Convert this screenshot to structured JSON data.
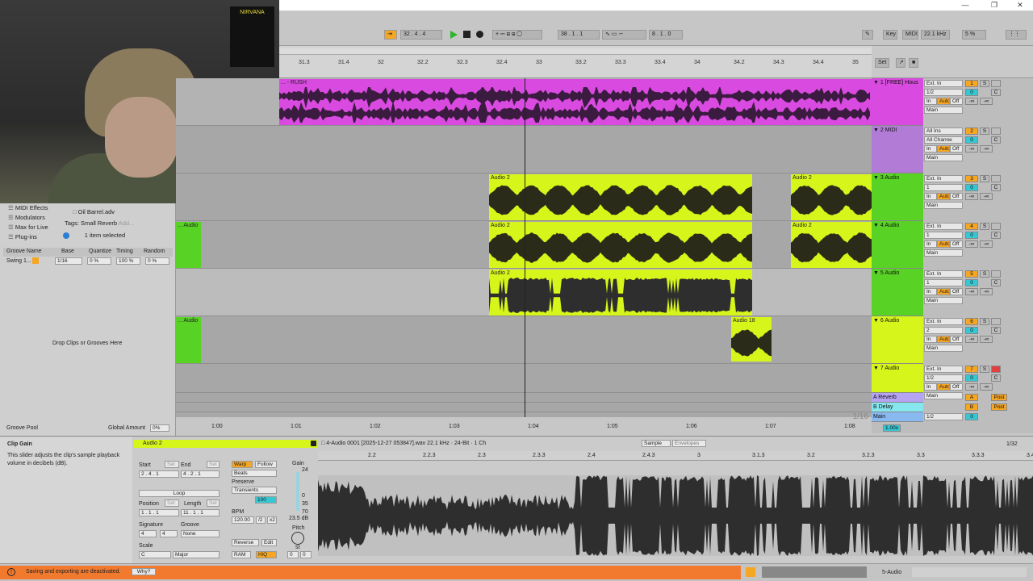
{
  "webcam": {
    "poster_text": "NIRVANA"
  },
  "transport": {
    "tempo_pos": "32 .  4 .  4",
    "loop_pos": "38 .  1 .  1",
    "loop_len": "8 .  1 .  0",
    "key_label": "Key",
    "midi_label": "MIDI",
    "sample_rate": "22.1 kHz",
    "cpu": "5 %"
  },
  "ruler": {
    "ticks": [
      "31.3",
      "31.4",
      "32",
      "32.2",
      "32.3",
      "32.4",
      "33",
      "33.2",
      "33.3",
      "33.4",
      "34",
      "34.2",
      "34.3",
      "34.4",
      "35"
    ],
    "set_label": "Set"
  },
  "time_ticks": [
    "1:00",
    "1:01",
    "1:02",
    "1:03",
    "1:04",
    "1:05",
    "1:06",
    "1:07",
    "1:08"
  ],
  "zoom_label": "1/16",
  "clips": {
    "rush": "... - RUSH",
    "audio2": "Audio 2",
    "audio18": "Audio 18",
    "left_audio": "... Audio"
  },
  "browser": {
    "midi_effects": "MIDI Effects",
    "modulators": "Modulators",
    "max_for_live": "Max for Live",
    "plugins": "Plug-ins",
    "file": "Oil Barrel.adv",
    "tags_label": "Tags:",
    "tags_value": "Small Reverb",
    "tags_add": "Add...",
    "selected": "1 item selected",
    "groove_headers": [
      "Groove Name",
      "Base",
      "Quantize",
      "Timing",
      "Random"
    ],
    "groove_row": [
      "Swing 1...",
      "1/16",
      "0 %",
      "100 %",
      "0 %"
    ],
    "drop_hint": "Drop Clips or Grooves Here",
    "groove_pool": "Groove Pool",
    "global_amount_label": "Global Amount",
    "global_amount_value": "0%"
  },
  "mixer": {
    "tracks": [
      {
        "name": "1 [FREE] Hous",
        "input": "Ext. In",
        "chan": "1/2",
        "num": "1",
        "vol": "0",
        "pan": "C",
        "out": "Main"
      },
      {
        "name": "2 MIDI",
        "input": "All Ins",
        "chan": "All Channe",
        "num": "2",
        "vol": "0",
        "pan": "C",
        "out": "Main"
      },
      {
        "name": "3 Audio",
        "input": "Ext. In",
        "chan": "1",
        "num": "3",
        "vol": "0",
        "pan": "C",
        "out": "Main"
      },
      {
        "name": "4 Audio",
        "input": "Ext. In",
        "chan": "1",
        "num": "4",
        "vol": "0",
        "pan": "C",
        "out": "Main"
      },
      {
        "name": "5 Audio",
        "input": "Ext. In",
        "chan": "1",
        "num": "5",
        "vol": "0",
        "pan": "C",
        "out": "Main"
      },
      {
        "name": "6 Audio",
        "input": "Ext. In",
        "chan": "2",
        "num": "6",
        "vol": "0",
        "pan": "C",
        "out": "Main"
      },
      {
        "name": "7 Audio",
        "input": "Ext. In",
        "chan": "1/2",
        "num": "7",
        "vol": "0",
        "pan": "C",
        "out": "Main"
      }
    ],
    "returns": [
      {
        "name": "A Reverb",
        "letter": "A",
        "post": "Post"
      },
      {
        "name": "B Delay",
        "letter": "B",
        "post": "Post"
      }
    ],
    "main": {
      "name": "Main",
      "chan": "1/2",
      "vol": "0"
    },
    "mon_in": "In",
    "mon_auto": "Auto",
    "mon_off": "Off",
    "inf": "-∞",
    "s": "S",
    "zoom": "1.00x"
  },
  "detail": {
    "info_title": "Clip Gain",
    "info_text": "This slider adjusts the clip's sample playback volume in decibels (dB).",
    "clip_name": "Audio 2",
    "start_label": "Start",
    "end_label": "End",
    "set": "Set",
    "start_val": "2 .  4 .  1",
    "end_val": "4 .  2 .  1",
    "loop": "Loop",
    "position_label": "Position",
    "length_label": "Length",
    "position_val": "1 .  1 .  1",
    "length_val": "11 .  1 .  1",
    "signature_label": "Signature",
    "sig_num": "4",
    "sig_den": "4",
    "groove_label": "Groove",
    "groove_val": "None",
    "scale_label": "Scale",
    "scale_root": "C",
    "scale_mode": "Major",
    "warp": "Warp",
    "follow": "Follow",
    "beats": "Beats",
    "preserve_label": "Preserve",
    "preserve_val": "Transients",
    "pct": "100",
    "bpm_label": "BPM",
    "bpm": "120.00",
    "half": "/2",
    "double": "x2",
    "gain_label": "Gain",
    "gain_db": "23.5 dB",
    "gain_top": "24",
    "gain_scale": [
      "0",
      "35",
      "70"
    ],
    "pitch_label": "Pitch",
    "pitch_st": "st",
    "pitch_val": "0",
    "pitch_cents": "0",
    "reverse": "Reverse",
    "edit": "Edit",
    "ram": "RAM",
    "hiq": "HiQ",
    "file_info": "4-Audio 0001 [2025-12-27 053847].wav  22.1 kHz · 24-Bit · 1 Ch",
    "tab_sample": "Sample",
    "tab_envelopes": "Envelopes",
    "grid": "1/32",
    "wave_ticks": [
      "2.2",
      "2.2.3",
      "2.3",
      "2.3.3",
      "2.4",
      "2.4.3",
      "3",
      "3.1.3",
      "3.2",
      "3.2.3",
      "3.3",
      "3.3.3",
      "3.4"
    ]
  },
  "status": {
    "message": "Saving and exporting are deactivated.",
    "why": "Why?",
    "track": "5-Audio"
  },
  "colors": {
    "magenta": "#d94ae0",
    "lime": "#d6f51a",
    "green": "#59d226",
    "orange": "#f5a623",
    "cyan": "#36c7d3",
    "status_orange": "#f27a2f"
  }
}
